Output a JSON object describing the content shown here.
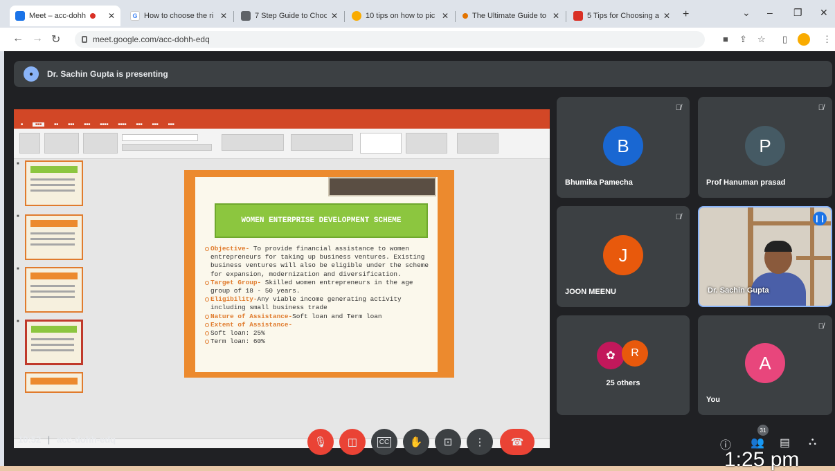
{
  "browser": {
    "tabs": [
      {
        "title": "Meet – acc-dohh",
        "active": true,
        "favicon_color": "#1a73e8"
      },
      {
        "title": "How to choose the ri",
        "active": false,
        "favicon_color": "#4285f4"
      },
      {
        "title": "7 Step Guide to Choo",
        "active": false,
        "favicon_color": "#5f6368"
      },
      {
        "title": "10 tips on how to pic",
        "active": false,
        "favicon_color": "#f9ab00"
      },
      {
        "title": "The Ultimate Guide to",
        "active": false,
        "favicon_color": "#e37400"
      },
      {
        "title": "5 Tips for Choosing a",
        "active": false,
        "favicon_color": "#d93025"
      }
    ],
    "url": "meet.google.com/acc-dohh-edq"
  },
  "meet": {
    "presenter_banner": "Dr. Sachin Gupta is presenting",
    "slide": {
      "heading": "WOMEN ENTERPRISE DEVELOPMENT SCHEME",
      "items": [
        {
          "key": "Objective-",
          "text": " To provide financial assistance to women entrepreneurs for taking up business ventures. Existing business ventures will also be eligible under the scheme for expansion, modernization and diversification."
        },
        {
          "key": "Target Group-",
          "text": " Skilled women entrepreneurs in the age group of 18 - 50 years."
        },
        {
          "key": "Eligibility-",
          "text": "Any viable income generating activity including small business trade"
        },
        {
          "key": "Nature of Assistance-",
          "text": "Soft loan and Term loan"
        },
        {
          "key": "Extent of Assistance-",
          "text": ""
        },
        {
          "key": "",
          "text": "Soft loan: 25%"
        },
        {
          "key": "",
          "text": "Term loan: 60%"
        }
      ]
    },
    "participants": [
      {
        "name": "Bhumika Pamecha",
        "initial": "B",
        "color": "#1967d2"
      },
      {
        "name": "Prof Hanuman prasad",
        "initial": "P",
        "color": "#455a64"
      },
      {
        "name": "JOON MEENU",
        "initial": "J",
        "color": "#e8590c"
      },
      {
        "name": "Dr. Sachin Gupta",
        "initial": "",
        "color": ""
      },
      {
        "name": "25 others",
        "initial": "R",
        "color": "#e8590c"
      },
      {
        "name": "You",
        "initial": "A",
        "color": "#e8467c"
      }
    ],
    "footer": {
      "time": "10:52",
      "meeting_code": "acc-dohh-edq",
      "people_count": "31"
    }
  },
  "os_time_overlay": "1:25 pm"
}
